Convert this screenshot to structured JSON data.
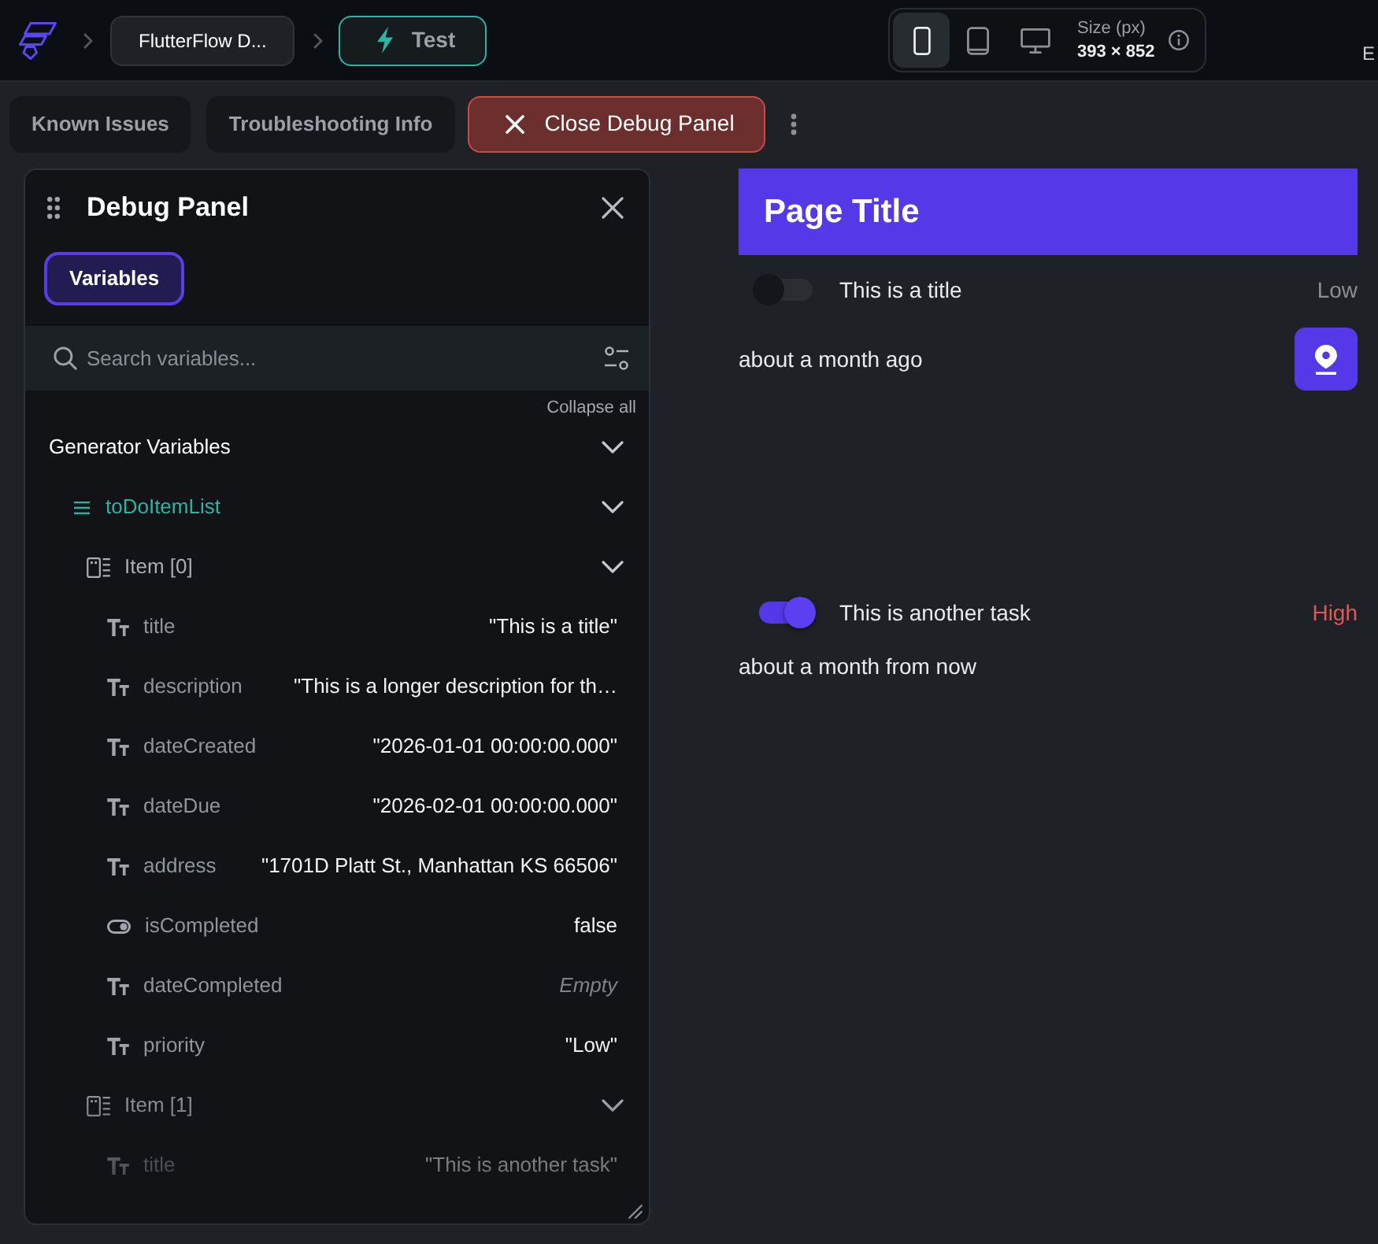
{
  "top_bar": {
    "breadcrumbs": [
      {
        "kind": "project",
        "label": "FlutterFlow D..."
      },
      {
        "kind": "test",
        "label": "Test"
      }
    ],
    "device_selector": {
      "devices": [
        {
          "kind": "phone",
          "selected": true
        },
        {
          "kind": "tablet",
          "selected": false
        },
        {
          "kind": "desktop",
          "selected": false
        }
      ],
      "size_label": "Size (px)",
      "size_value": "393 × 852"
    },
    "cut_text": "E"
  },
  "toolbar": {
    "buttons": [
      {
        "kind": "plain",
        "label": "Known Issues"
      },
      {
        "kind": "plain",
        "label": "Troubleshooting Info"
      },
      {
        "kind": "danger",
        "label": "Close Debug Panel"
      }
    ]
  },
  "debug_panel": {
    "title": "Debug Panel",
    "tabs": [
      {
        "label": "Variables",
        "selected": true
      }
    ],
    "search": {
      "placeholder": "Search variables..."
    },
    "collapse_all": "Collapse all",
    "tree": [
      {
        "kind": "group",
        "label": "Generator Variables",
        "expanded": true,
        "children": [
          {
            "kind": "list",
            "label": "toDoItemList",
            "expanded": true,
            "children": [
              {
                "kind": "item",
                "label": "Item [0]",
                "expanded": true,
                "children": [
                  {
                    "kind": "string",
                    "label": "title",
                    "value": "\"This is a title\"",
                    "empty": false
                  },
                  {
                    "kind": "string",
                    "label": "description",
                    "value": "\"This is a longer description for th…",
                    "empty": false
                  },
                  {
                    "kind": "string",
                    "label": "dateCreated",
                    "value": "\"2026-01-01 00:00:00.000\"",
                    "empty": false
                  },
                  {
                    "kind": "string",
                    "label": "dateDue",
                    "value": "\"2026-02-01 00:00:00.000\"",
                    "empty": false
                  },
                  {
                    "kind": "string",
                    "label": "address",
                    "value": "\"1701D Platt St., Manhattan KS 66506\"",
                    "empty": false
                  },
                  {
                    "kind": "boolean",
                    "label": "isCompleted",
                    "value": "false",
                    "empty": false
                  },
                  {
                    "kind": "string",
                    "label": "dateCompleted",
                    "value": "Empty",
                    "empty": true
                  },
                  {
                    "kind": "string",
                    "label": "priority",
                    "value": "\"Low\"",
                    "empty": false
                  }
                ]
              },
              {
                "kind": "item",
                "label": "Item [1]",
                "expanded": true,
                "children": [
                  {
                    "kind": "string",
                    "label": "title",
                    "value": "\"This is another task\"",
                    "empty": false
                  }
                ]
              }
            ]
          }
        ]
      }
    ]
  },
  "preview": {
    "page_title": "Page Title",
    "tasks": [
      {
        "title": "This is a title",
        "done": false,
        "priority": "Low",
        "color": "#8a8f95",
        "due": "about a month ago",
        "location_button": true
      },
      {
        "title": "This is another task",
        "done": true,
        "priority": "High",
        "color": "#e0575a",
        "due": "about a month from now",
        "location_button": false
      }
    ]
  }
}
